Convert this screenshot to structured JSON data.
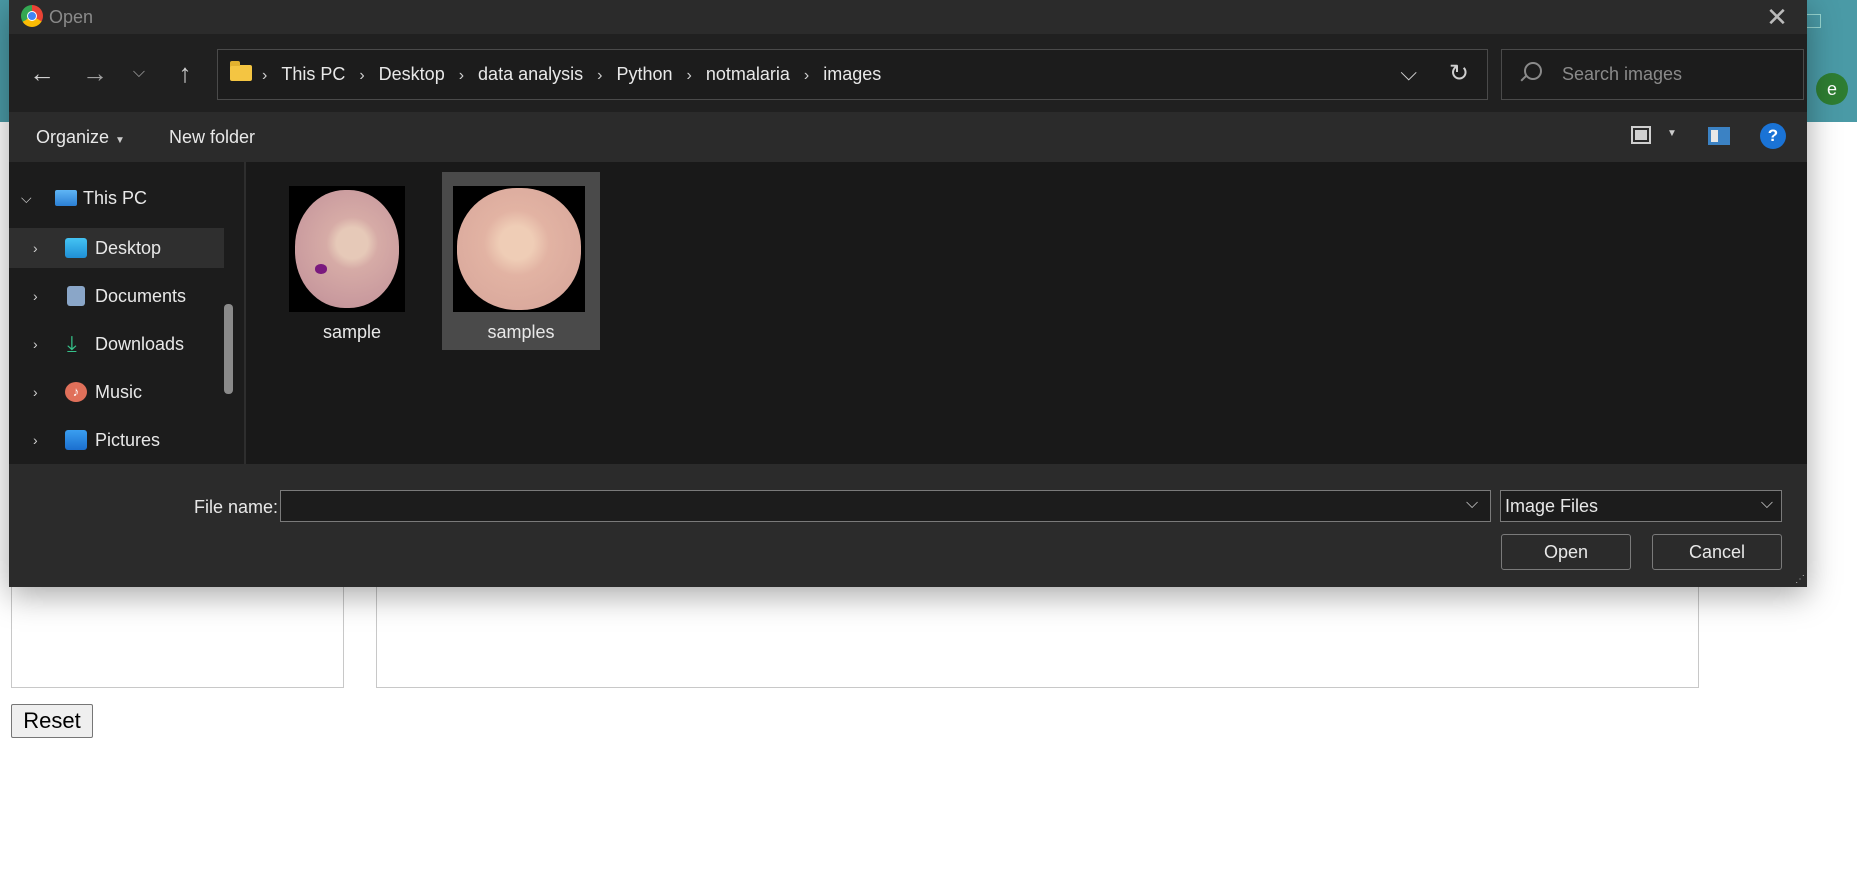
{
  "background": {
    "avatar_letter": "e",
    "reset_label": "Reset"
  },
  "dialog": {
    "title": "Open",
    "address": {
      "crumbs": [
        "This PC",
        "Desktop",
        "data analysis",
        "Python",
        "notmalaria",
        "images"
      ]
    },
    "search": {
      "placeholder": "Search images"
    },
    "toolbar": {
      "organize_label": "Organize",
      "new_folder_label": "New folder",
      "help_label": "?"
    },
    "sidebar": {
      "root_label": "This PC",
      "items": [
        {
          "label": "Desktop",
          "icon": "desktop-icon"
        },
        {
          "label": "Documents",
          "icon": "documents-icon"
        },
        {
          "label": "Downloads",
          "icon": "downloads-icon"
        },
        {
          "label": "Music",
          "icon": "music-icon"
        },
        {
          "label": "Pictures",
          "icon": "pictures-icon"
        }
      ]
    },
    "files": [
      {
        "name": "sample",
        "selected": false
      },
      {
        "name": "samples",
        "selected": true
      }
    ],
    "footer": {
      "file_name_label": "File name:",
      "file_name_value": "",
      "filter_value": "Image Files",
      "open_label": "Open",
      "cancel_label": "Cancel"
    }
  }
}
